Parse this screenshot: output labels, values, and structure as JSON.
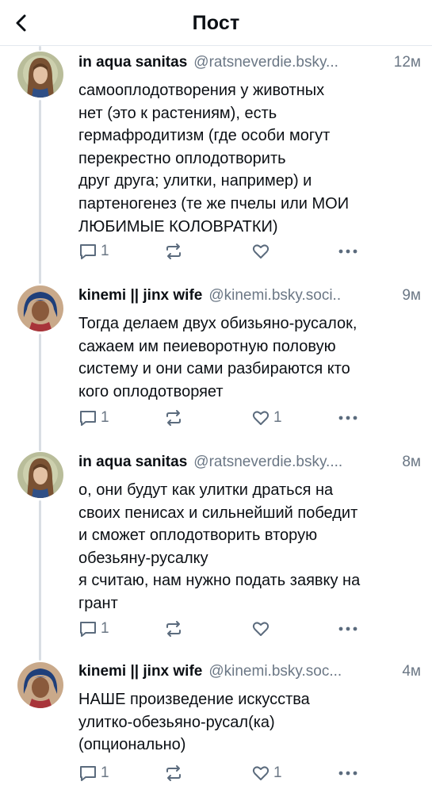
{
  "header": {
    "title": "Пост",
    "back_icon": "chevron-left-icon"
  },
  "colors": {
    "text": "#0b0f14",
    "muted": "#6b7785",
    "icon": "#5b6b7d",
    "thread_line": "#d9dee4",
    "divider": "#e3e8ee"
  },
  "posts": [
    {
      "author": "in aqua sanitas",
      "handle": "@ratsneverdie.bsky...",
      "time": "12м",
      "avatar_icon": "avatar-long-hair-man",
      "lines": [
        "самооплодотворения у животных",
        "нет (это к растениям), есть",
        "гермафродитизм (где особи могут",
        "перекрестно оплодотворить",
        "друг друга; улитки, например) и",
        "партеногенез (те же пчелы или МОИ",
        "ЛЮБИМЫЕ КОЛОВРАТКИ)"
      ],
      "reply_count": "1",
      "repost_count": "",
      "like_count": ""
    },
    {
      "author": "kinemi || jinx wife",
      "handle": "@kinemi.bsky.soci..",
      "time": "9м",
      "avatar_icon": "avatar-blue-hair-character",
      "lines": [
        "Тогда делаем двух обизьяно-русалок,",
        "сажаем им пеиеворотную половую",
        "систему и они сами разбираются кто",
        "кого оплодотворяет"
      ],
      "reply_count": "1",
      "repost_count": "",
      "like_count": "1"
    },
    {
      "author": "in aqua sanitas",
      "handle": "@ratsneverdie.bsky....",
      "time": "8м",
      "avatar_icon": "avatar-long-hair-man",
      "lines": [
        "о, они будут как улитки драться на",
        "своих пенисах и сильнейший победит",
        "и сможет оплодотворить вторую",
        "обезьяну-русалку",
        "я считаю, нам нужно подать заявку на",
        "грант"
      ],
      "reply_count": "1",
      "repost_count": "",
      "like_count": ""
    },
    {
      "author": "kinemi || jinx wife",
      "handle": "@kinemi.bsky.soc...",
      "time": "4м",
      "avatar_icon": "avatar-blue-hair-character",
      "lines": [
        "НАШЕ произведение искусства",
        "улитко-обезьяно-русал(ка)",
        "(опционально)"
      ],
      "reply_count": "1",
      "repost_count": "",
      "like_count": "1"
    }
  ],
  "action_icons": {
    "reply": "reply-bubble-icon",
    "repost": "repost-icon",
    "like": "heart-icon",
    "more": "more-dots-icon"
  }
}
